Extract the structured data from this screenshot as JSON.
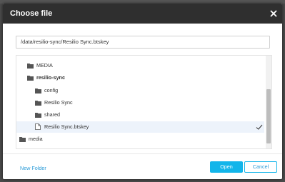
{
  "dialog": {
    "title": "Choose file",
    "close_icon": "close-icon"
  },
  "path_input": {
    "value": "/data/resilio-sync/Resilio Sync.btskey"
  },
  "tree": {
    "items": [
      {
        "label": "MEDIA",
        "icon": "folder-icon",
        "bold": false,
        "selected": false
      },
      {
        "label": "resilio-sync",
        "icon": "folder-icon",
        "bold": true,
        "selected": false
      },
      {
        "label": "config",
        "icon": "folder-icon",
        "bold": false,
        "selected": false
      },
      {
        "label": "Resilio Sync",
        "icon": "folder-icon",
        "bold": false,
        "selected": false
      },
      {
        "label": "shared",
        "icon": "folder-icon",
        "bold": false,
        "selected": false
      },
      {
        "label": "Resilio Sync.btskey",
        "icon": "file-icon",
        "bold": false,
        "selected": true,
        "check_icon": "checkmark-icon"
      },
      {
        "label": "media",
        "icon": "folder-icon",
        "bold": false,
        "selected": false
      }
    ]
  },
  "footer": {
    "new_folder_label": "New Folder",
    "open_label": "Open",
    "cancel_label": "Cancel"
  },
  "colors": {
    "header_bg": "#2f2f2f",
    "accent": "#13b5ea",
    "link": "#2a9bd8",
    "selected_row": "#edf3fb"
  }
}
